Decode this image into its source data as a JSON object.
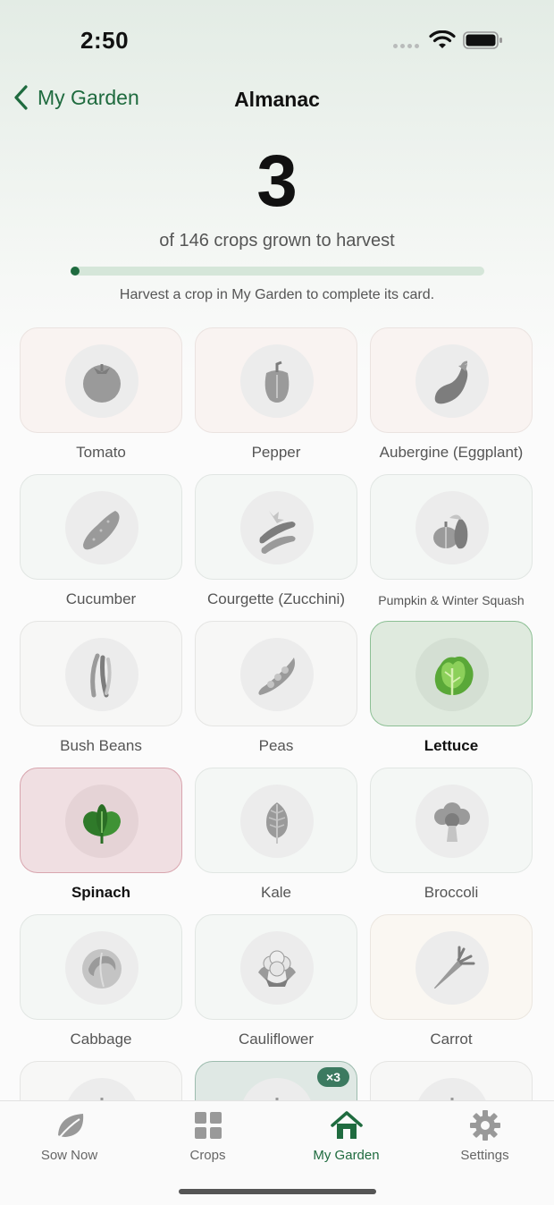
{
  "status_bar": {
    "time": "2:50"
  },
  "nav": {
    "back_label": "My Garden",
    "title": "Almanac"
  },
  "stats": {
    "harvested_count": "3",
    "subtitle": "of 146 crops grown to harvest",
    "progress_fraction": 0.02,
    "hint": "Harvest a crop in My Garden to complete its card."
  },
  "crops": [
    {
      "label": "Tomato",
      "icon": "tomato-icon",
      "harvested": false
    },
    {
      "label": "Pepper",
      "icon": "pepper-icon",
      "harvested": false
    },
    {
      "label": "Aubergine (Eggplant)",
      "icon": "aubergine-icon",
      "harvested": false
    },
    {
      "label": "Cucumber",
      "icon": "cucumber-icon",
      "harvested": false
    },
    {
      "label": "Courgette (Zucchini)",
      "icon": "courgette-icon",
      "harvested": false
    },
    {
      "label": "Pumpkin & Winter Squash",
      "icon": "pumpkin-icon",
      "harvested": false
    },
    {
      "label": "Bush Beans",
      "icon": "beans-icon",
      "harvested": false
    },
    {
      "label": "Peas",
      "icon": "peas-icon",
      "harvested": false
    },
    {
      "label": "Lettuce",
      "icon": "lettuce-icon",
      "harvested": true
    },
    {
      "label": "Spinach",
      "icon": "spinach-icon",
      "harvested": true
    },
    {
      "label": "Kale",
      "icon": "kale-icon",
      "harvested": false
    },
    {
      "label": "Broccoli",
      "icon": "broccoli-icon",
      "harvested": false
    },
    {
      "label": "Cabbage",
      "icon": "cabbage-icon",
      "harvested": false
    },
    {
      "label": "Cauliflower",
      "icon": "cauliflower-icon",
      "harvested": false
    },
    {
      "label": "Carrot",
      "icon": "carrot-icon",
      "harvested": false
    },
    {
      "label": "",
      "icon": "crop-icon",
      "harvested": false
    },
    {
      "label": "",
      "icon": "crop-icon",
      "harvested": true,
      "badge": "×3"
    },
    {
      "label": "",
      "icon": "crop-icon",
      "harvested": false
    }
  ],
  "tabs": [
    {
      "label": "Sow Now",
      "icon": "leaf-icon",
      "active": false
    },
    {
      "label": "Crops",
      "icon": "grid-icon",
      "active": false
    },
    {
      "label": "My Garden",
      "icon": "house-icon",
      "active": true
    },
    {
      "label": "Settings",
      "icon": "gear-icon",
      "active": false
    }
  ],
  "colors": {
    "accent": "#1f6b3f",
    "progress_track": "#d5e6d9",
    "harvested_green": "#dfeade",
    "harvested_pink": "#f0dfe2"
  }
}
